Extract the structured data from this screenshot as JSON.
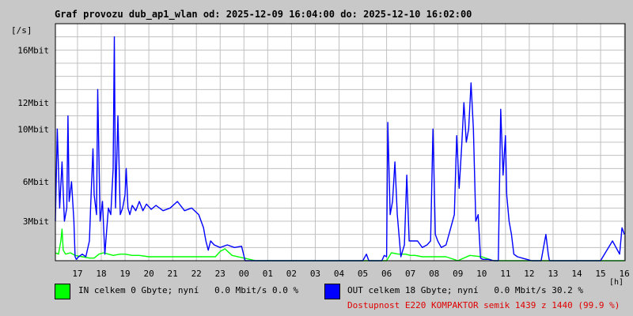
{
  "title": "Graf provozu dub_ap1_wlan od: 2025-12-09 16:04:00 do: 2025-12-10 16:02:00",
  "legend": {
    "in_text": "IN celkem 0 Gbyte; nyní   0.0 Mbit/s 0.0 %",
    "out_text": "OUT celkem 18 Gbyte; nyní   0.0 Mbit/s 30.2 %",
    "in_color": "#00ff00",
    "out_color": "#0000ff",
    "availability": "Dostupnost E220 KOMPAKTOR semik 1439 z 1440 (99.9 %)",
    "availability_color": "#e00000"
  },
  "chart_data": {
    "type": "line",
    "ylabel": "[/s]",
    "xlabel": "[h]",
    "x_ticks": [
      "17",
      "18",
      "19",
      "20",
      "21",
      "22",
      "23",
      "00",
      "01",
      "02",
      "03",
      "04",
      "05",
      "06",
      "07",
      "08",
      "09",
      "10",
      "11",
      "12",
      "13",
      "14",
      "15",
      "16"
    ],
    "y_ticks": [
      {
        "label": "3Mbit",
        "value": 3
      },
      {
        "label": "6Mbit",
        "value": 6
      },
      {
        "label": "10Mbit",
        "value": 10
      },
      {
        "label": "12Mbit",
        "value": 12
      },
      {
        "label": "16Mbit",
        "value": 16
      }
    ],
    "ylim": [
      0,
      18
    ],
    "xlim": [
      16.07,
      40.03
    ],
    "grid": true,
    "series": [
      {
        "name": "IN",
        "color": "#00ff00",
        "x": [
          16.07,
          16.2,
          16.3,
          16.35,
          16.4,
          16.5,
          16.7,
          16.9,
          17.2,
          17.5,
          17.7,
          17.9,
          18.1,
          18.3,
          18.5,
          18.8,
          19.0,
          19.3,
          19.6,
          20.0,
          20.5,
          21.0,
          21.5,
          22.0,
          22.4,
          22.8,
          23.0,
          23.2,
          23.5,
          24.0,
          24.5,
          25.0,
          26.0,
          27.0,
          28.0,
          29.0,
          29.8,
          30.0,
          30.2,
          30.5,
          30.8,
          31.0,
          31.2,
          31.5,
          31.8,
          32.0,
          32.3,
          32.5,
          33.0,
          33.5,
          34.0,
          34.5,
          35.0,
          35.5,
          36.0,
          37.0,
          38.0,
          39.0,
          40.0
        ],
        "y": [
          0.6,
          0.5,
          1.5,
          2.4,
          0.8,
          0.5,
          0.6,
          0.4,
          0.3,
          0.2,
          0.2,
          0.5,
          0.6,
          0.5,
          0.4,
          0.5,
          0.5,
          0.4,
          0.4,
          0.3,
          0.3,
          0.3,
          0.3,
          0.3,
          0.3,
          0.3,
          0.7,
          0.9,
          0.4,
          0.2,
          0.0,
          0.0,
          0.0,
          0.0,
          0.0,
          0.0,
          0.0,
          0.0,
          0.6,
          0.5,
          0.5,
          0.4,
          0.4,
          0.3,
          0.3,
          0.3,
          0.3,
          0.3,
          0.0,
          0.4,
          0.3,
          0.0,
          0.0,
          0.0,
          0.0,
          0.0,
          0.0,
          0.0,
          0.0
        ]
      },
      {
        "name": "OUT",
        "color": "#0000ff",
        "x": [
          16.07,
          16.15,
          16.25,
          16.35,
          16.45,
          16.55,
          16.6,
          16.65,
          16.75,
          16.85,
          16.9,
          16.95,
          17.05,
          17.2,
          17.35,
          17.5,
          17.55,
          17.65,
          17.7,
          17.8,
          17.85,
          17.95,
          18.05,
          18.15,
          18.3,
          18.4,
          18.5,
          18.55,
          18.6,
          18.7,
          18.8,
          18.9,
          19.0,
          19.05,
          19.12,
          19.2,
          19.3,
          19.45,
          19.6,
          19.75,
          19.9,
          20.1,
          20.3,
          20.6,
          20.9,
          21.2,
          21.5,
          21.8,
          22.1,
          22.3,
          22.4,
          22.5,
          22.6,
          22.75,
          23.0,
          23.3,
          23.6,
          23.9,
          24.05,
          24.2,
          24.5,
          25.0,
          25.5,
          26.0,
          26.5,
          27.0,
          27.5,
          28.0,
          28.5,
          29.0,
          29.15,
          29.25,
          29.4,
          29.6,
          29.8,
          29.9,
          30.0,
          30.05,
          30.15,
          30.25,
          30.35,
          30.45,
          30.6,
          30.75,
          30.85,
          30.95,
          31.1,
          31.3,
          31.5,
          31.7,
          31.85,
          31.95,
          32.05,
          32.15,
          32.3,
          32.5,
          32.7,
          32.85,
          32.95,
          33.05,
          33.15,
          33.25,
          33.35,
          33.45,
          33.55,
          33.65,
          33.75,
          33.85,
          33.95,
          34.05,
          34.15,
          34.3,
          34.5,
          34.7,
          34.8,
          34.9,
          35.0,
          35.05,
          35.15,
          35.25,
          35.35,
          35.5,
          35.7,
          35.9,
          36.1,
          36.3,
          36.5,
          36.7,
          36.8,
          36.85,
          36.95,
          37.1,
          37.3,
          37.5,
          37.7,
          37.9,
          38.1,
          38.5,
          39.0,
          39.5,
          39.8,
          39.9,
          40.0
        ],
        "y": [
          3.0,
          10.0,
          4.0,
          7.5,
          3.0,
          4.0,
          11.0,
          4.5,
          6.0,
          3.0,
          0.3,
          0.1,
          0.3,
          0.5,
          0.3,
          1.5,
          4.0,
          8.5,
          5.0,
          3.5,
          13.0,
          3.0,
          4.5,
          0.5,
          4.0,
          3.5,
          7.0,
          17.0,
          4.0,
          11.0,
          3.5,
          4.0,
          5.0,
          7.0,
          4.0,
          3.5,
          4.2,
          3.8,
          4.5,
          3.8,
          4.3,
          3.9,
          4.2,
          3.8,
          4.0,
          4.5,
          3.8,
          4.0,
          3.5,
          2.5,
          1.5,
          0.8,
          1.5,
          1.2,
          1.0,
          1.2,
          1.0,
          1.1,
          0.0,
          0.0,
          0.0,
          0.0,
          0.0,
          0.0,
          0.0,
          0.0,
          0.0,
          0.0,
          0.0,
          0.0,
          0.5,
          0.0,
          0.0,
          0.0,
          0.0,
          0.4,
          0.3,
          10.5,
          3.5,
          4.5,
          7.5,
          3.5,
          0.3,
          1.2,
          6.5,
          1.5,
          1.5,
          1.5,
          1.0,
          1.2,
          1.5,
          10.0,
          2.0,
          1.5,
          1.0,
          1.2,
          2.5,
          3.5,
          9.5,
          5.5,
          8.5,
          12.0,
          9.0,
          10.0,
          13.5,
          10.0,
          3.0,
          3.5,
          0.2,
          0.1,
          0.1,
          0.1,
          0.0,
          0.0,
          11.5,
          6.5,
          9.5,
          5.0,
          3.0,
          2.0,
          0.5,
          0.3,
          0.2,
          0.1,
          0.0,
          0.0,
          0.0,
          2.0,
          0.5,
          0.0,
          0.0,
          0.0,
          0.0,
          0.0,
          0.0,
          0.0,
          0.0,
          0.0,
          0.0,
          1.5,
          0.5,
          2.5,
          2.0
        ]
      }
    ]
  }
}
